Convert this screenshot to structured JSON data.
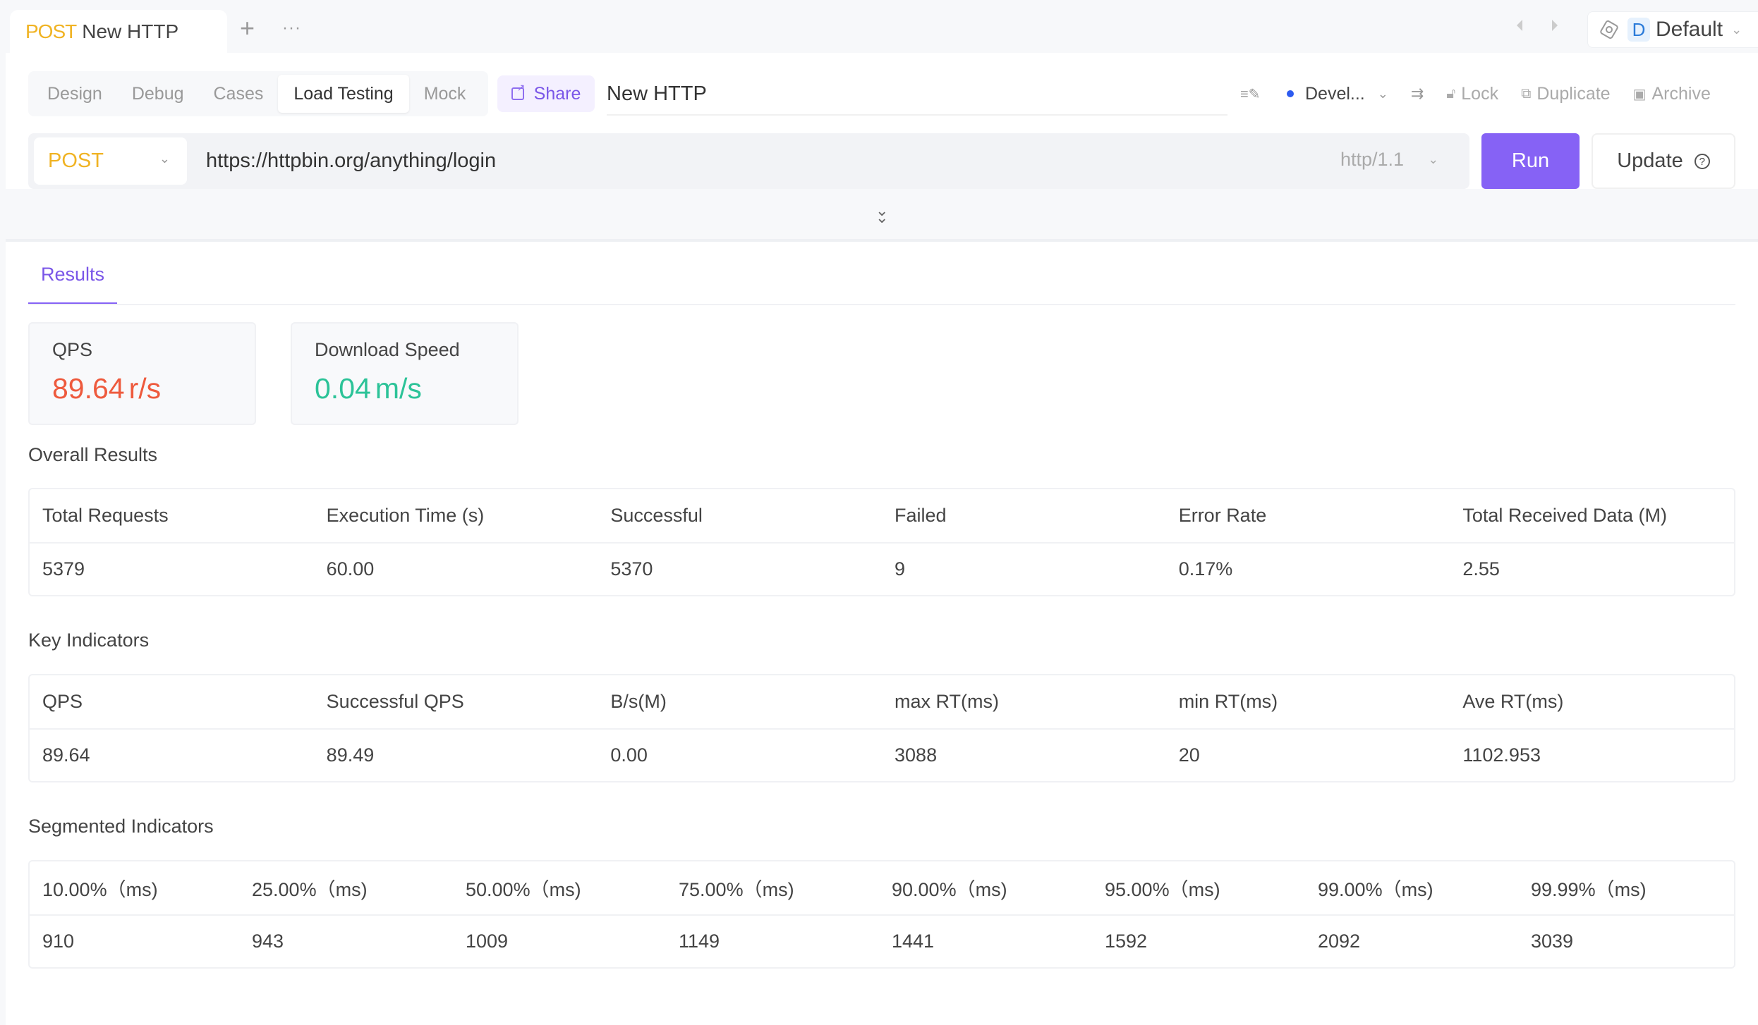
{
  "file_tab": {
    "method": "POST",
    "name": "New HTTP"
  },
  "topbar": {
    "add_icon": "+",
    "more_icon": "···"
  },
  "env_selector": {
    "badge": "D",
    "label": "Default",
    "chevron": "⌄"
  },
  "subtabs": [
    {
      "label": "Design",
      "active": false
    },
    {
      "label": "Debug",
      "active": false
    },
    {
      "label": "Cases",
      "active": false
    },
    {
      "label": "Load Testing",
      "active": true
    },
    {
      "label": "Mock",
      "active": false
    }
  ],
  "share_label": "Share",
  "title_value": "New HTTP",
  "toolbar": {
    "environment": "Devel...",
    "env_status_color": "#2d5bf0",
    "lock_label": "Lock",
    "duplicate_label": "Duplicate",
    "archive_label": "Archive"
  },
  "request": {
    "method": "POST",
    "url": "https://httpbin.org/anything/login",
    "protocol": "http/1.1",
    "run_label": "Run",
    "update_label": "Update"
  },
  "results_tab": "Results",
  "cards": {
    "qps": {
      "label": "QPS",
      "value": "89.64",
      "unit": "r/s",
      "color": "#ee5a3d"
    },
    "download": {
      "label": "Download Speed",
      "value": "0.04",
      "unit": "m/s",
      "color": "#2cc398"
    }
  },
  "overall": {
    "title": "Overall Results",
    "headers": [
      "Total Requests",
      "Execution Time (s)",
      "Successful",
      "Failed",
      "Error Rate",
      "Total Received Data (M)"
    ],
    "values": [
      "5379",
      "60.00",
      "5370",
      "9",
      "0.17%",
      "2.55"
    ]
  },
  "key": {
    "title": "Key Indicators",
    "headers": [
      "QPS",
      "Successful QPS",
      "B/s(M)",
      "max RT(ms)",
      "min RT(ms)",
      "Ave RT(ms)"
    ],
    "values": [
      "89.64",
      "89.49",
      "0.00",
      "3088",
      "20",
      "1102.953"
    ]
  },
  "segmented": {
    "title": "Segmented Indicators",
    "headers": [
      "10.00%（ms)",
      "25.00%（ms)",
      "50.00%（ms)",
      "75.00%（ms)",
      "90.00%（ms)",
      "95.00%（ms)",
      "99.00%（ms)",
      "99.99%（ms)"
    ],
    "values": [
      "910",
      "943",
      "1009",
      "1149",
      "1441",
      "1592",
      "2092",
      "3039"
    ]
  },
  "colors": {
    "accent": "#8662f5",
    "method": "#f0b323"
  }
}
